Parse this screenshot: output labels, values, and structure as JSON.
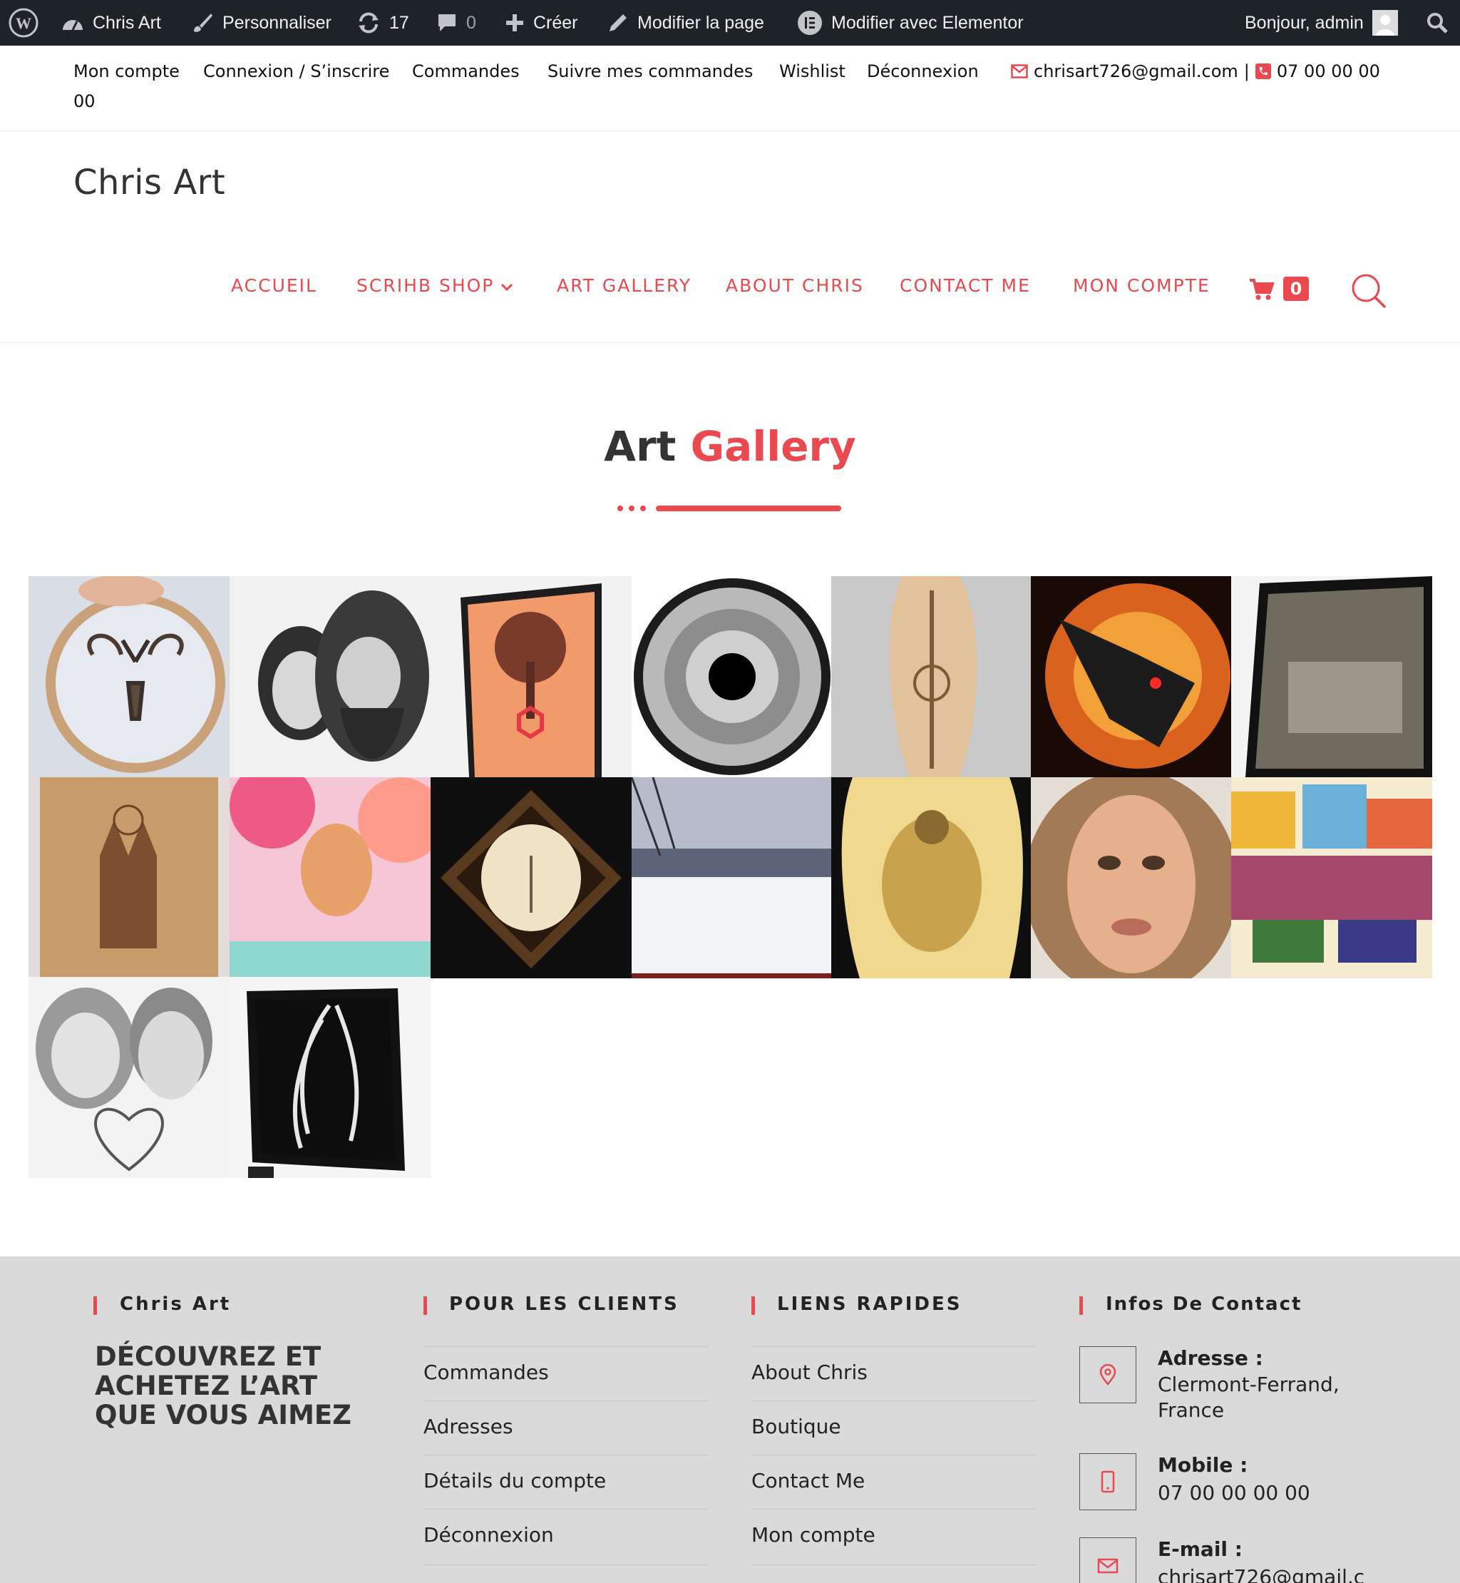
{
  "admin_bar": {
    "site_name": "Chris Art",
    "customize": "Personnaliser",
    "updates_count": "17",
    "comments_count": "0",
    "create": "Créer",
    "edit_page": "Modifier la page",
    "edit_elementor": "Modifier avec Elementor",
    "greeting": "Bonjour, admin"
  },
  "topbar": {
    "links": [
      "Mon compte",
      "Connexion / S’inscrire",
      "Commandes",
      "Suivre mes commandes",
      "Wishlist",
      "Déconnexion"
    ],
    "email": "chrisart726@gmail.com",
    "separator": "|",
    "phone_part1": "07 00 00 00",
    "phone_part2": "00"
  },
  "header": {
    "site_title": "Chris Art",
    "nav": [
      "ACCUEIL",
      "SCRIHB SHOP",
      "ART GALLERY",
      "ABOUT CHRIS",
      "CONTACT ME",
      "MON COMPTE"
    ],
    "cart_count": "0"
  },
  "gallery": {
    "title_part1": "Art",
    "title_part2": "Gallery",
    "items": [
      "wood-slice-deer",
      "portrait-couple-sketch",
      "framed-tree-of-life",
      "iris-eye",
      "wooden-board-pyrography",
      "fire-dragon",
      "framed-dark-painting",
      "wood-cathedral",
      "watercolor-woman",
      "framed-stag-diamond",
      "winter-landscape",
      "warrior-pyrography",
      "woman-portrait",
      "colorful-market",
      "couple-heart-sketch",
      "framed-white-hair"
    ]
  },
  "footer": {
    "col1": {
      "heading": "Chris Art",
      "tagline": "DÉCOUVREZ ET ACHETEZ L’ART QUE VOUS AIMEZ"
    },
    "col2": {
      "heading": "POUR LES CLIENTS",
      "links": [
        "Commandes",
        "Adresses",
        "Détails du compte",
        "Déconnexion"
      ]
    },
    "col3": {
      "heading": "LIENS RAPIDES",
      "links": [
        "About Chris",
        "Boutique",
        "Contact Me",
        "Mon compte"
      ]
    },
    "col4": {
      "heading": "Infos De Contact",
      "address_label": "Adresse :",
      "address_value": "Clermont-Ferrand, France",
      "mobile_label": "Mobile :",
      "mobile_value": "07 00 00 00 00",
      "email_label": "E-mail :",
      "email_value": "chrisart726@gmail.c"
    }
  },
  "colors": {
    "accent": "#e9494f",
    "admin_bg": "#1d2327",
    "footer_bg": "#dadada"
  }
}
